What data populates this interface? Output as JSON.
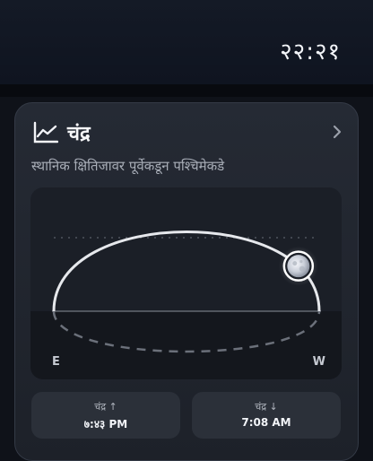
{
  "status": {
    "time": "२२:२१"
  },
  "card": {
    "title": "चंद्र",
    "subtitle": "स्थानिक क्षितिजावर पूर्वेकडून पश्चिमेकडे",
    "icons": {
      "chart": "chart-line-icon",
      "chevron": "chevron-right-icon",
      "moon": "moon-icon"
    },
    "direction_east": "E",
    "direction_west": "W",
    "moon_position_fraction": 0.85,
    "moonrise": {
      "label": "चंद्र ↑",
      "time": "७:४३ PM"
    },
    "moonset": {
      "label": "चंद्र ↓",
      "time": "7:08 AM"
    }
  },
  "colors": {
    "background": "#0f1219",
    "card": "#22262f",
    "arc": "#e6e8ec",
    "text_secondary": "#a9aeb8"
  }
}
